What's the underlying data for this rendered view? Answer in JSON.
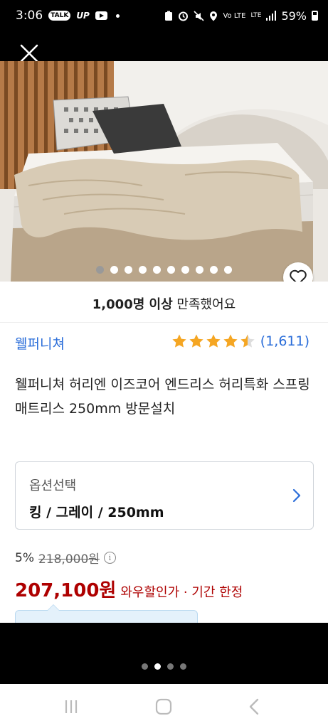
{
  "status_bar": {
    "time": "3:06",
    "talk_badge": "TALK",
    "up_label": "UP",
    "network_label": "LTE",
    "battery_percent": "59%"
  },
  "hero": {
    "image_description_icon": "mattress-photo",
    "carousel": {
      "count": 10,
      "active_index": 0
    }
  },
  "product": {
    "satisfied_bold": "1,000명 이상",
    "satisfied_rest": " 만족했어요",
    "brand": "웰퍼니쳐",
    "rating": 4.5,
    "rating_count": "(1,611)",
    "title": "웰퍼니쳐 허리엔 이즈코어 엔드리스 허리특화 스프링 매트리스 250mm 방문설치",
    "option_label": "옵션선택",
    "option_value": "킹 / 그레이 / 250mm",
    "discount_percent": "5%",
    "original_price": "218,000원",
    "price": "207,100원",
    "price_note": "와우할인가 · 기간 한정"
  },
  "pager": {
    "count": 4,
    "active_index": 1
  },
  "colors": {
    "brand_blue": "#2a6dd9",
    "price_red": "#ae0000",
    "star_orange": "#f5a623"
  }
}
